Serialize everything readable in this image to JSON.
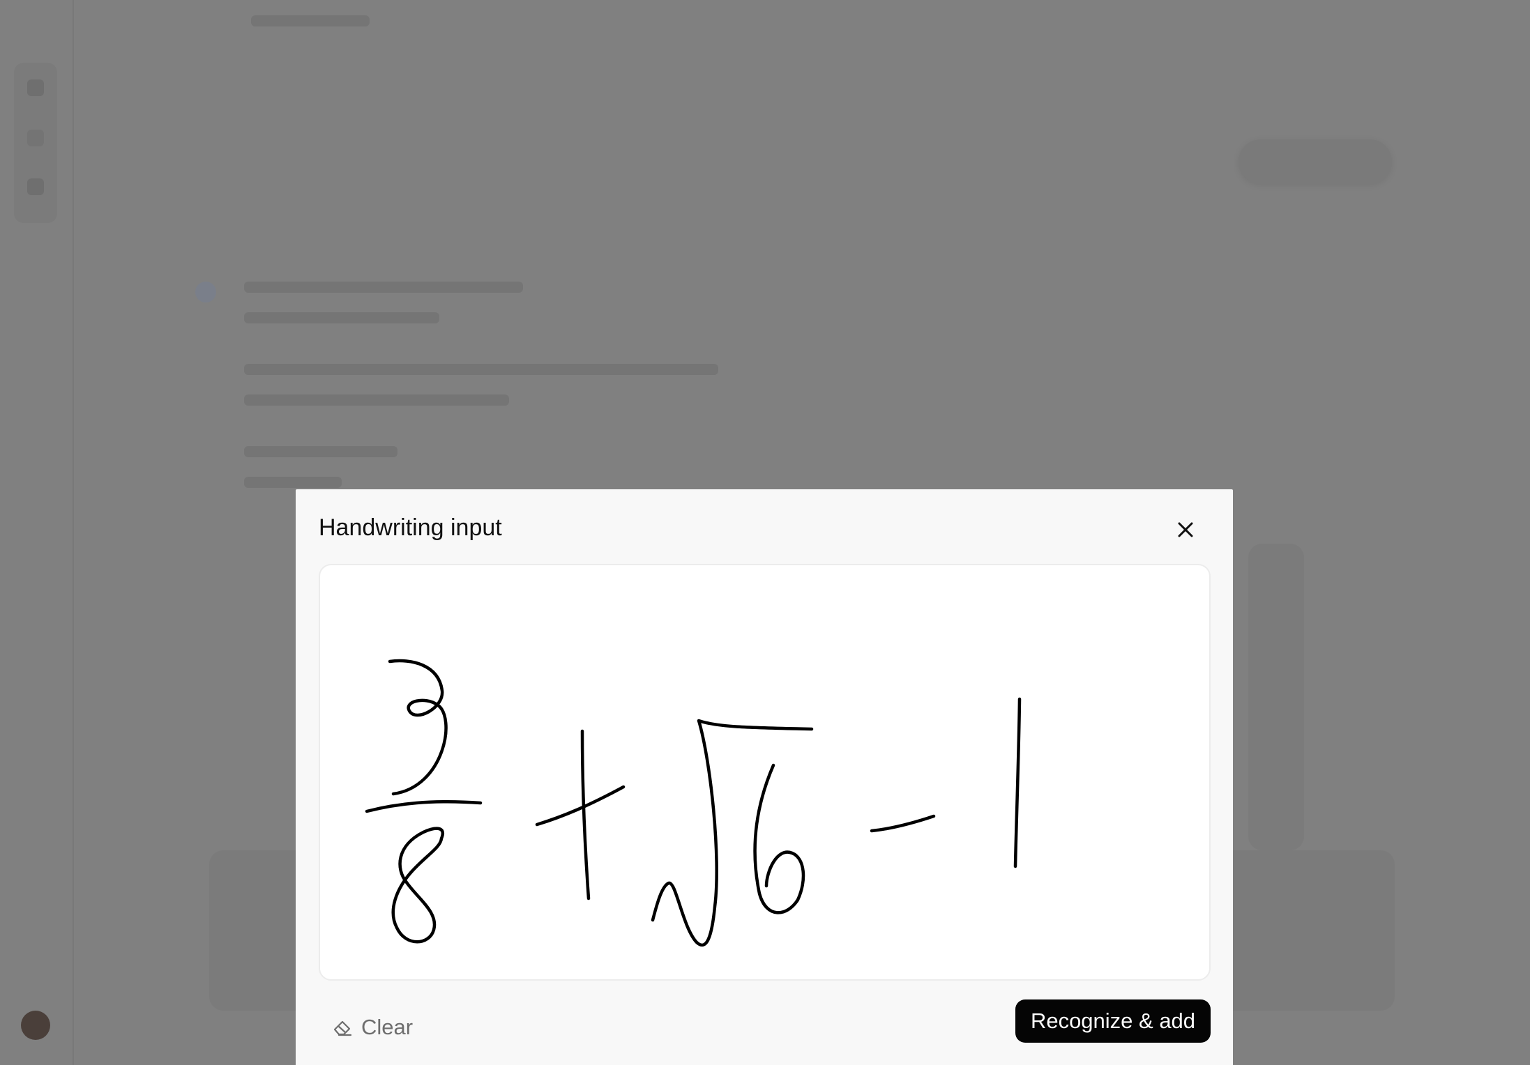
{
  "dialog": {
    "title": "Handwriting input",
    "close_icon": "close-icon",
    "canvas": {
      "stroke_color": "#000000",
      "background": "#ffffff",
      "content": "handwritten expression 3/8 + √6 - 1"
    },
    "clear_label": "Clear",
    "clear_icon": "eraser-icon",
    "primary_label": "Recognize & add",
    "primary_color": "#050505"
  },
  "overlay_color": "#808080"
}
